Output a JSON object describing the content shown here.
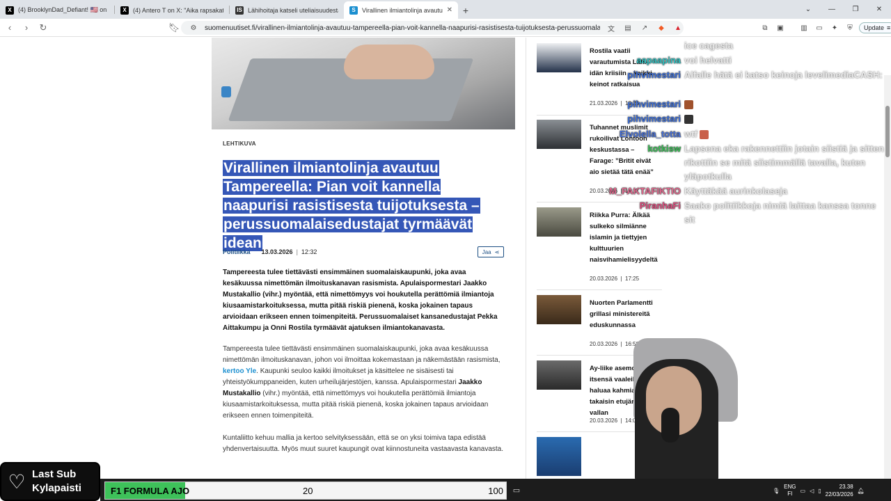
{
  "browser": {
    "tabs": [
      {
        "title": "(4) BrooklynDad_Defiant! 🇺🇸 on X: \"",
        "icon": "x-logo-icon",
        "active": false
      },
      {
        "title": "(4) Antero T on X: \"Aika rapsakat luke",
        "icon": "x-logo-icon",
        "active": false
      },
      {
        "title": "Lähihoitaja katseli uteliaisuudesta sa",
        "icon": "site-logo-icon",
        "active": false
      },
      {
        "title": "Virallinen ilmiantolinja avautuu Tampe",
        "icon": "suomenuutiset-icon",
        "active": true
      }
    ],
    "url": "suomenuutiset.fi/virallinen-ilmiantolinja-avautuu-tampereella-pian-voit-kannella-naapurisi-rasistisesta-tuijotuksesta-perussuomalaisedust...",
    "update_label": "Update"
  },
  "article": {
    "image_credit": "LEHTIKUVA",
    "headline": "Virallinen ilmiantolinja avautuu Tampereella: Pian voit kannella naapurisi rasistisesta tuijotuksesta – perussuomalaisedustajat tyrmäävät idean",
    "category": "Politiikka",
    "date": "13.03.2026",
    "time": "12:32",
    "share_label": "Jaa",
    "lead": "Tampereesta tulee tiettävästi ensimmäinen suomalaiskaupunki, joka avaa kesäkuussa nimettömän ilmoituskanavan rasismista. Apulaispormestari Jaakko Mustakallio (vihr.) myöntää, että nimettömyys voi houkutella perättömiä ilmiantoja kiusaamistarkoituksessa, mutta pitää riskiä pienenä, koska jokainen tapaus arvioidaan erikseen ennen toimenpiteitä. Perussuomalaiset kansanedustajat Pekka Aittakumpu ja Onni Rostila tyrmäävät ajatuksen ilmiantokanavasta.",
    "body1_a": "Tampereesta tulee tiettävästi ensimmäinen suomalaiskaupunki, joka avaa kesäkuussa nimettömän ilmoituskanavan,  johon voi ilmoittaa kokemastaan ja näkemästään rasismista, ",
    "body1_link": "kertoo Yle",
    "body1_b": ". Kaupunki seuloo kaikki ilmoitukset ja käsittelee ne sisäisesti tai yhteistyökumppaneiden, kuten urheilujärjestöjen, kanssa. Apulaispormestari ",
    "body1_name": "Jaakko Mustakallio",
    "body1_c": " (vihr.) myöntää, että nimettömyys voi houkutella perättömiä ilmiantoja kiusaamistarkoituksessa, mutta pitää riskiä pienenä, koska jokainen tapaus arvioidaan erikseen ennen toimenpiteitä.",
    "body2": "Kuntaliitto kehuu mallia ja kertoo selvityksessään, että se on yksi toimiva tapa edistää yhdenvertaisuutta. Myös muut suuret kaupungit ovat kiinnostuneita vastaavasta kanavasta."
  },
  "sidebar": {
    "items": [
      {
        "title": "Rostila vaatii varautumista Lähi-idän kriisiin – kaikki keinot ratkaisua",
        "date": "21.03.2026",
        "time": "10:26"
      },
      {
        "title": "Tuhannet muslimit rukoilivat Lontoon keskustassa – Farage: ”Britit eivät aio sietää tätä enää”",
        "date": "20.03.2026",
        "time": "19:17"
      },
      {
        "title": "Riikka Purra: Älkää sulkeko silmiänne islamin ja tiettyjen kulttuurien naisvihamielisyydeltä",
        "date": "20.03.2026",
        "time": "17:25"
      },
      {
        "title": "Nuorten Parlamentti grillasi ministereitä eduskunnassa",
        "date": "20.03.2026",
        "time": "16:58"
      },
      {
        "title": "Ay-liike asemoi itsensä vaaleihin – haluaa kahmia takaisin etujärjestöjen vallan",
        "date": "20.03.2026",
        "time": "14:01"
      },
      {
        "title": "",
        "date": "",
        "time": ""
      }
    ]
  },
  "chat": {
    "messages": [
      {
        "user": "",
        "text": "ice cagesta",
        "color": "#ffffff"
      },
      {
        "user": "aapaapina",
        "text": "voi helvatti",
        "color": "#34c3c3"
      },
      {
        "user": "pihvimestari",
        "text": "Alfalle hätä ei katso keinoja levelimediaCASH:",
        "color": "#3d6fd8"
      },
      {
        "user": "pihvimestari",
        "text": "",
        "color": "#3d6fd8"
      },
      {
        "user": "pihvimestari",
        "text": "",
        "color": "#3d6fd8"
      },
      {
        "user": "Elvolella_totta",
        "text": "wtf",
        "color": "#4a72d6"
      },
      {
        "user": "kotkisw",
        "text": "Lapsena eka rakennettiin jotain siistiä ja sitten rikottiin se mitä siistimmällä tavalla, kuten yläpotkulla",
        "color": "#3ec15a"
      },
      {
        "user": "M_FAKTAFIKTIO",
        "text": "Käyttäkää aurinkolaseja",
        "color": "#e06a8e"
      },
      {
        "user": "PiranhaFi",
        "text": "Saako politiikkoja nimiä laittaa kanssa tonne sit",
        "color": "#e05080"
      }
    ]
  },
  "widgets": {
    "last_sub_title": "Last Sub",
    "last_sub_name": "Kylapaisti",
    "goal_label": "F1 FORMULA AJO",
    "goal_current": "20",
    "goal_max": "100",
    "goal_fraction": 0.2
  },
  "system_tray": {
    "lang_top": "ENG",
    "lang_bottom": "FI",
    "time": "23.38",
    "date": "22/03/2026"
  }
}
